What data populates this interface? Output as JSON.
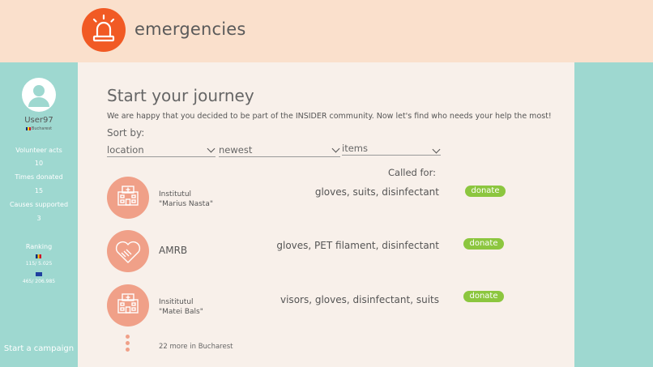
{
  "header": {
    "brand": "emergencies",
    "logo_icon": "siren-icon"
  },
  "sidebar": {
    "username": "User97",
    "location": "Bucharest",
    "stats": [
      {
        "label": "Volunteer acts",
        "value": "10"
      },
      {
        "label": "Times donated",
        "value": "15"
      },
      {
        "label": "Causes supported",
        "value": "3"
      }
    ],
    "ranking": {
      "label": "Ranking",
      "country": "115/ 5.025",
      "europe": "465/ 206.985"
    },
    "campaign": "Start a campaign"
  },
  "main": {
    "title": "Start your journey",
    "intro": "We are happy that you decided to be part of the INSIDER community. Now let's find who needs your help the most!",
    "sort_label": "Sort by:",
    "sorts": [
      "location",
      "newest",
      "items"
    ],
    "called_for": "Called for:",
    "orgs": [
      {
        "name_line1": "Institutul",
        "name_line2": "\"Marius Nasta\"",
        "needs": "gloves, suits, disinfectant",
        "action": "donate"
      },
      {
        "name_line1": "AMRB",
        "needs": "gloves, PET filament, disinfectant",
        "action": "donate"
      },
      {
        "name_line1": "Insititutul",
        "name_line2": "\"Matei Bals\"",
        "needs": "visors, gloves, disinfectant, suits",
        "action": "donate"
      }
    ],
    "more": "22 more in Bucharest"
  },
  "colors": {
    "accent": "#f15a24",
    "donate": "#8cc63f",
    "sidebar": "#9ed8d0",
    "header": "#fae0cc",
    "org": "#f0a088"
  }
}
